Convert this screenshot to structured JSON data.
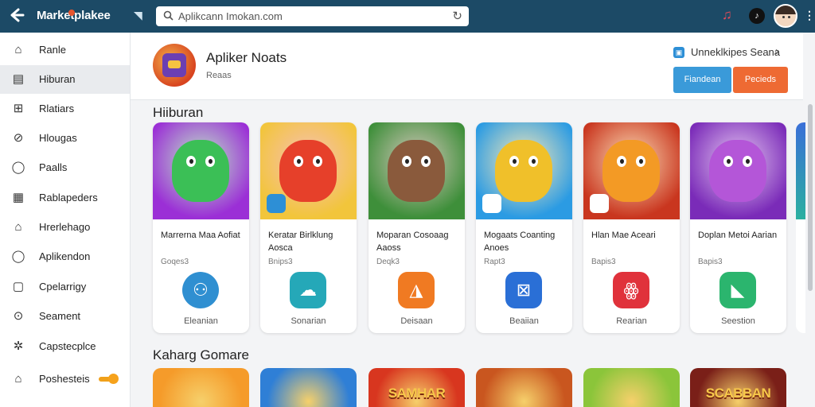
{
  "topbar": {
    "brand": "Marketplakee",
    "url": "Aplikcann Imokan.com",
    "icons": [
      "back-arrow-icon",
      "search-icon",
      "reload-icon",
      "music-icon",
      "tiktok-icon",
      "user-avatar"
    ]
  },
  "sidebar": {
    "items": [
      {
        "label": "Ranle",
        "icon": "⌂"
      },
      {
        "label": "Hiburan",
        "icon": "▤"
      },
      {
        "label": "Rlatiars",
        "icon": "⊞"
      },
      {
        "label": "Hlougas",
        "icon": "⊘"
      },
      {
        "label": "Paalls",
        "icon": "◯"
      },
      {
        "label": "Rablapeders",
        "icon": "▦"
      },
      {
        "label": "Hrerlehago",
        "icon": "⌂"
      },
      {
        "label": "Aplikendon",
        "icon": "◯"
      },
      {
        "label": "Cpelarrigy",
        "icon": "▢"
      },
      {
        "label": "Seament",
        "icon": "⊙"
      },
      {
        "label": "Capstecplce",
        "icon": "✲"
      },
      {
        "label": "Poshesteis",
        "icon": "⌂"
      }
    ]
  },
  "header": {
    "title": "Apliker Noats",
    "subtitle": "Reaas",
    "link_label": "Unneklkipes Seana",
    "button_primary": "Fiandean",
    "button_secondary": "Pecieds"
  },
  "sections": [
    {
      "title": "Hiiburan",
      "cards": [
        {
          "name": "Marrerna Maa Aofiat",
          "meta": "Goqes3",
          "action": "Eleanian",
          "art_bg": "#9b2fd6",
          "char": "#3bbf56",
          "app_color": "#2f8fd1",
          "app_glyph": "⚇",
          "app_shape": "round"
        },
        {
          "name": "Keratar Birlklung Aosca",
          "meta": "Bnips3",
          "action": "Sonarian",
          "art_bg": "#f2c53b",
          "char": "#e6402a",
          "app_color": "#25a8b8",
          "app_glyph": "☁",
          "app_shape": "square"
        },
        {
          "name": "Moparan Cosoaag Aaoss",
          "meta": "Deqk3",
          "action": "Deisaan",
          "art_bg": "#3e8f3a",
          "char": "#8a5a3c",
          "app_color": "#f07a22",
          "app_glyph": "◮",
          "app_shape": "square"
        },
        {
          "name": "Mogaats Coanting Anoes",
          "meta": "Rapt3",
          "action": "Beaiian",
          "art_bg": "#2b9be3",
          "char": "#f0c02a",
          "app_color": "#2a6fd6",
          "app_glyph": "⊠",
          "app_shape": "square"
        },
        {
          "name": "Hlan Mae Aceari",
          "meta": "Bapis3",
          "action": "Rearian",
          "art_bg": "#c9361f",
          "char": "#f39a25",
          "app_color": "#e0323b",
          "app_glyph": "ꙮ",
          "app_shape": "square"
        },
        {
          "name": "Doplan Metoi Aarian",
          "meta": "Bapis3",
          "action": "Seestion",
          "art_bg": "#7a2bb8",
          "char": "#b456d8",
          "app_color": "#2bb56e",
          "app_glyph": "◣",
          "app_shape": "square"
        }
      ]
    },
    {
      "title": "Kaharg Gomare",
      "cards": [
        {
          "label": "",
          "bg": "#f59b2a"
        },
        {
          "label": "",
          "bg": "#2f7fd6"
        },
        {
          "label": "SAMHAR",
          "bg": "#d8361f"
        },
        {
          "label": "",
          "bg": "#c9561f"
        },
        {
          "label": "",
          "bg": "#8bc53a"
        },
        {
          "label": "SCABBAN",
          "bg": "#7a1f18"
        }
      ]
    }
  ]
}
